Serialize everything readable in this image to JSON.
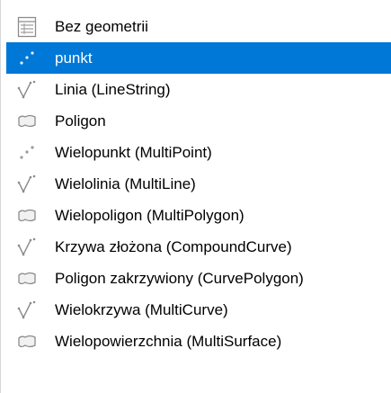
{
  "menu": {
    "items": [
      {
        "label": "Bez geometrii",
        "icon": "table-icon",
        "selected": false
      },
      {
        "label": "punkt",
        "icon": "point-icon",
        "selected": true
      },
      {
        "label": "Linia (LineString)",
        "icon": "line-icon",
        "selected": false
      },
      {
        "label": "Poligon",
        "icon": "polygon-icon",
        "selected": false
      },
      {
        "label": "Wielopunkt (MultiPoint)",
        "icon": "point-icon",
        "selected": false
      },
      {
        "label": "Wielolinia (MultiLine)",
        "icon": "line-icon",
        "selected": false
      },
      {
        "label": "Wielopoligon (MultiPolygon)",
        "icon": "polygon-icon",
        "selected": false
      },
      {
        "label": "Krzywa złożona (CompoundCurve)",
        "icon": "line-icon",
        "selected": false
      },
      {
        "label": "Poligon zakrzywiony (CurvePolygon)",
        "icon": "polygon-icon",
        "selected": false
      },
      {
        "label": "Wielokrzywa (MultiCurve)",
        "icon": "line-icon",
        "selected": false
      },
      {
        "label": "Wielopowierzchnia (MultiSurface)",
        "icon": "polygon-icon",
        "selected": false
      }
    ]
  },
  "colors": {
    "selected_background": "#0078d7",
    "selected_text": "#ffffff",
    "text": "#000000",
    "icon_gray": "#9a9a9a"
  }
}
